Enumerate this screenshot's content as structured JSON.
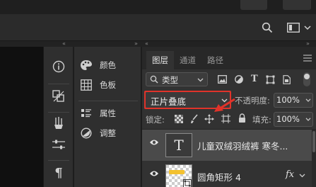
{
  "colors": {
    "highlight_box": "#e0332a",
    "selected_row": "#4a4a4a",
    "arrow": "#e0332a"
  },
  "optbar": {
    "icons": [
      "search-icon",
      "workspace-icon",
      "chevron-down-icon"
    ]
  },
  "dock_icons": [
    "info-icon",
    "transform-icon",
    "brushes-icon",
    "adjust-sliders-icon",
    "paragraph-icon"
  ],
  "panels": [
    {
      "icon": "palette-icon",
      "label": "颜色"
    },
    {
      "icon": "swatches-icon",
      "label": "色板"
    },
    {
      "icon": "properties-icon",
      "label": "属性"
    },
    {
      "icon": "adjustments-icon",
      "label": "调整"
    }
  ],
  "tabs": [
    {
      "label": "图层",
      "active": true
    },
    {
      "label": "通道",
      "active": false
    },
    {
      "label": "路径",
      "active": false
    }
  ],
  "filter": {
    "label": "类型",
    "icons": [
      "image-filter-icon",
      "adjustment-filter-icon",
      "type-filter-icon",
      "shape-filter-icon",
      "smart-object-filter-icon"
    ]
  },
  "blend": {
    "mode": "正片叠底"
  },
  "opacity": {
    "label": "不透明度:",
    "value": "100%"
  },
  "lock": {
    "label": "锁定:",
    "icons": [
      "lock-transparent-icon",
      "lock-pixels-icon",
      "lock-position-icon",
      "lock-artboard-icon",
      "lock-all-icon"
    ]
  },
  "fill": {
    "label": "填充:",
    "value": "100%"
  },
  "layers": [
    {
      "name": "儿童双绒羽绒裤 寒冬...",
      "type": "text",
      "thumb_text": "T",
      "selected": true,
      "visible": true
    },
    {
      "name": "圆角矩形 4",
      "type": "shape",
      "selected": false,
      "visible": true,
      "fx": "fx"
    }
  ]
}
